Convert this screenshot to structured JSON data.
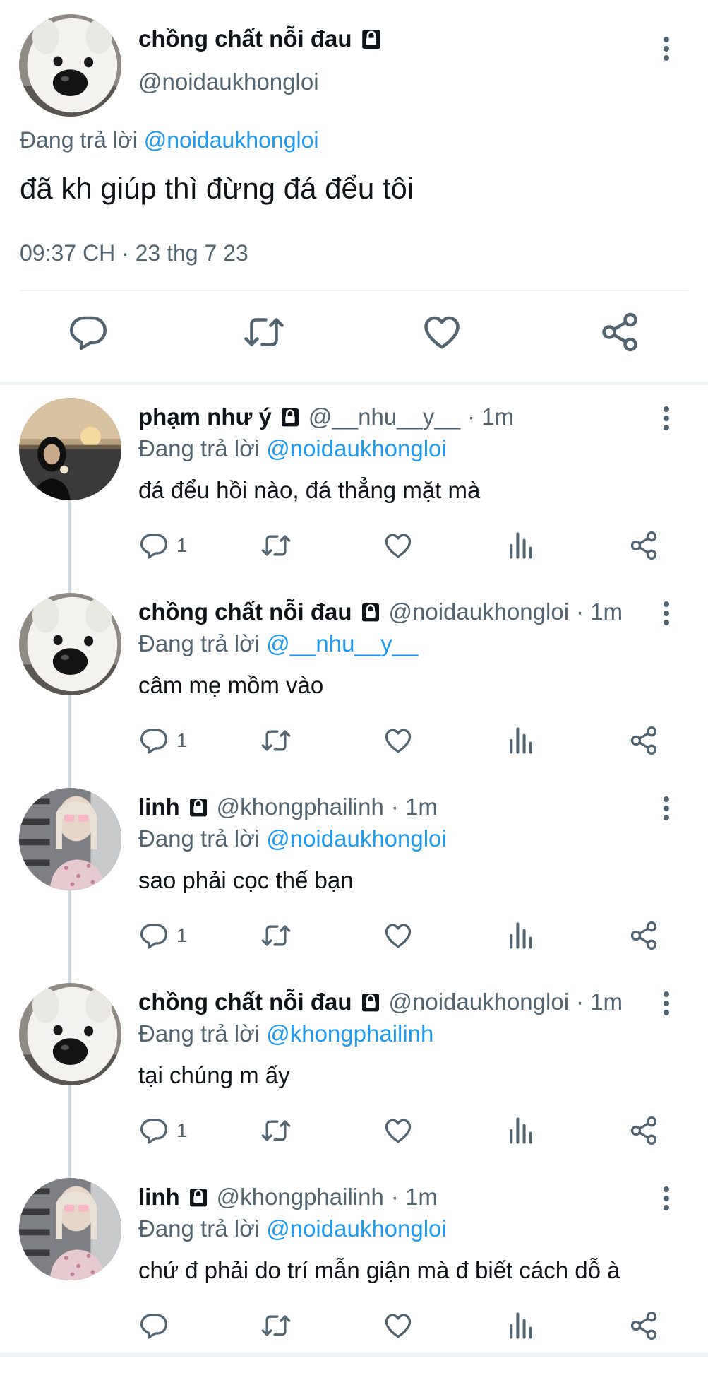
{
  "main_tweet": {
    "name": "chồng chất nỗi đau",
    "handle": "@noidaukhongloi",
    "reply_prefix": "Đang trả lời",
    "reply_to": "@noidaukhongloi",
    "text": "đã kh giúp thì đừng đá đểu tôi",
    "timestamp": "09:37 CH · 23 thg 7 23"
  },
  "replies": [
    {
      "name": "phạm như ý",
      "handle": "@__nhu__y__",
      "time": "· 1m",
      "reply_prefix": "Đang trả lời",
      "reply_to": "@noidaukhongloi",
      "text": "đá đểu hồi nào, đá thẳng mặt mà",
      "reply_count": "1"
    },
    {
      "name": "chồng chất nỗi đau",
      "handle": "@noidaukhongloi",
      "time": "· 1m",
      "reply_prefix": "Đang trả lời",
      "reply_to": "@__nhu__y__",
      "text": "câm mẹ mồm vào",
      "reply_count": "1"
    },
    {
      "name": "linh",
      "handle": "@khongphailinh",
      "time": "· 1m",
      "reply_prefix": "Đang trả lời",
      "reply_to": "@noidaukhongloi",
      "text": "sao phải cọc thế bạn",
      "reply_count": "1"
    },
    {
      "name": "chồng chất nỗi đau",
      "handle": "@noidaukhongloi",
      "time": "· 1m",
      "reply_prefix": "Đang trả lời",
      "reply_to": "@khongphailinh",
      "text": "tại chúng m ấy",
      "reply_count": "1"
    },
    {
      "name": "linh",
      "handle": "@khongphailinh",
      "time": "· 1m",
      "reply_prefix": "Đang trả lời",
      "reply_to": "@noidaukhongloi",
      "text": "chứ đ phải do trí mẫn giận mà đ biết cách dỗ à",
      "reply_count": ""
    }
  ],
  "colors": {
    "link": "#1d9bf0",
    "secondary": "#536471",
    "text": "#0f1419",
    "divider": "#eff3f4"
  },
  "icons": [
    "reply-icon",
    "retweet-icon",
    "like-icon",
    "views-icon",
    "share-icon",
    "lock-icon",
    "more-icon"
  ]
}
